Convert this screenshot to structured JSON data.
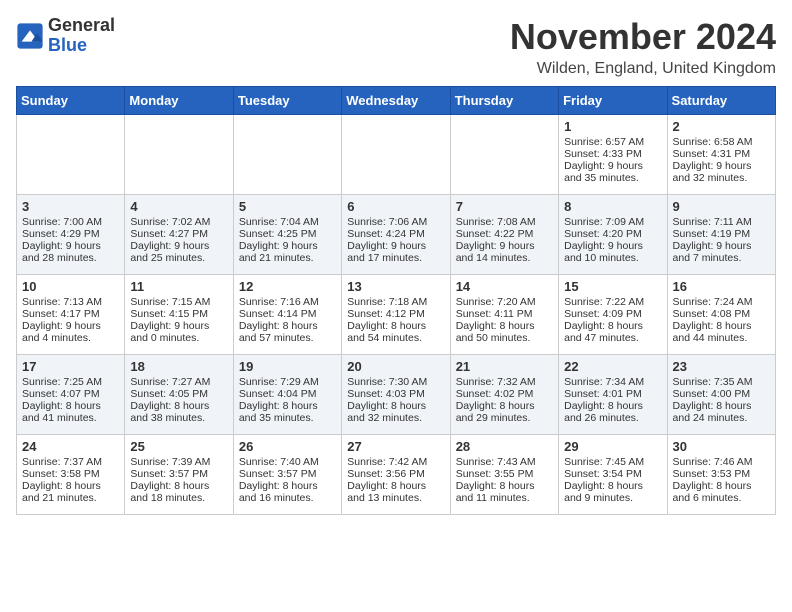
{
  "header": {
    "logo_general": "General",
    "logo_blue": "Blue",
    "month_title": "November 2024",
    "location": "Wilden, England, United Kingdom"
  },
  "days_of_week": [
    "Sunday",
    "Monday",
    "Tuesday",
    "Wednesday",
    "Thursday",
    "Friday",
    "Saturday"
  ],
  "weeks": [
    [
      {
        "day": "",
        "info": ""
      },
      {
        "day": "",
        "info": ""
      },
      {
        "day": "",
        "info": ""
      },
      {
        "day": "",
        "info": ""
      },
      {
        "day": "",
        "info": ""
      },
      {
        "day": "1",
        "info": "Sunrise: 6:57 AM\nSunset: 4:33 PM\nDaylight: 9 hours\nand 35 minutes."
      },
      {
        "day": "2",
        "info": "Sunrise: 6:58 AM\nSunset: 4:31 PM\nDaylight: 9 hours\nand 32 minutes."
      }
    ],
    [
      {
        "day": "3",
        "info": "Sunrise: 7:00 AM\nSunset: 4:29 PM\nDaylight: 9 hours\nand 28 minutes."
      },
      {
        "day": "4",
        "info": "Sunrise: 7:02 AM\nSunset: 4:27 PM\nDaylight: 9 hours\nand 25 minutes."
      },
      {
        "day": "5",
        "info": "Sunrise: 7:04 AM\nSunset: 4:25 PM\nDaylight: 9 hours\nand 21 minutes."
      },
      {
        "day": "6",
        "info": "Sunrise: 7:06 AM\nSunset: 4:24 PM\nDaylight: 9 hours\nand 17 minutes."
      },
      {
        "day": "7",
        "info": "Sunrise: 7:08 AM\nSunset: 4:22 PM\nDaylight: 9 hours\nand 14 minutes."
      },
      {
        "day": "8",
        "info": "Sunrise: 7:09 AM\nSunset: 4:20 PM\nDaylight: 9 hours\nand 10 minutes."
      },
      {
        "day": "9",
        "info": "Sunrise: 7:11 AM\nSunset: 4:19 PM\nDaylight: 9 hours\nand 7 minutes."
      }
    ],
    [
      {
        "day": "10",
        "info": "Sunrise: 7:13 AM\nSunset: 4:17 PM\nDaylight: 9 hours\nand 4 minutes."
      },
      {
        "day": "11",
        "info": "Sunrise: 7:15 AM\nSunset: 4:15 PM\nDaylight: 9 hours\nand 0 minutes."
      },
      {
        "day": "12",
        "info": "Sunrise: 7:16 AM\nSunset: 4:14 PM\nDaylight: 8 hours\nand 57 minutes."
      },
      {
        "day": "13",
        "info": "Sunrise: 7:18 AM\nSunset: 4:12 PM\nDaylight: 8 hours\nand 54 minutes."
      },
      {
        "day": "14",
        "info": "Sunrise: 7:20 AM\nSunset: 4:11 PM\nDaylight: 8 hours\nand 50 minutes."
      },
      {
        "day": "15",
        "info": "Sunrise: 7:22 AM\nSunset: 4:09 PM\nDaylight: 8 hours\nand 47 minutes."
      },
      {
        "day": "16",
        "info": "Sunrise: 7:24 AM\nSunset: 4:08 PM\nDaylight: 8 hours\nand 44 minutes."
      }
    ],
    [
      {
        "day": "17",
        "info": "Sunrise: 7:25 AM\nSunset: 4:07 PM\nDaylight: 8 hours\nand 41 minutes."
      },
      {
        "day": "18",
        "info": "Sunrise: 7:27 AM\nSunset: 4:05 PM\nDaylight: 8 hours\nand 38 minutes."
      },
      {
        "day": "19",
        "info": "Sunrise: 7:29 AM\nSunset: 4:04 PM\nDaylight: 8 hours\nand 35 minutes."
      },
      {
        "day": "20",
        "info": "Sunrise: 7:30 AM\nSunset: 4:03 PM\nDaylight: 8 hours\nand 32 minutes."
      },
      {
        "day": "21",
        "info": "Sunrise: 7:32 AM\nSunset: 4:02 PM\nDaylight: 8 hours\nand 29 minutes."
      },
      {
        "day": "22",
        "info": "Sunrise: 7:34 AM\nSunset: 4:01 PM\nDaylight: 8 hours\nand 26 minutes."
      },
      {
        "day": "23",
        "info": "Sunrise: 7:35 AM\nSunset: 4:00 PM\nDaylight: 8 hours\nand 24 minutes."
      }
    ],
    [
      {
        "day": "24",
        "info": "Sunrise: 7:37 AM\nSunset: 3:58 PM\nDaylight: 8 hours\nand 21 minutes."
      },
      {
        "day": "25",
        "info": "Sunrise: 7:39 AM\nSunset: 3:57 PM\nDaylight: 8 hours\nand 18 minutes."
      },
      {
        "day": "26",
        "info": "Sunrise: 7:40 AM\nSunset: 3:57 PM\nDaylight: 8 hours\nand 16 minutes."
      },
      {
        "day": "27",
        "info": "Sunrise: 7:42 AM\nSunset: 3:56 PM\nDaylight: 8 hours\nand 13 minutes."
      },
      {
        "day": "28",
        "info": "Sunrise: 7:43 AM\nSunset: 3:55 PM\nDaylight: 8 hours\nand 11 minutes."
      },
      {
        "day": "29",
        "info": "Sunrise: 7:45 AM\nSunset: 3:54 PM\nDaylight: 8 hours\nand 9 minutes."
      },
      {
        "day": "30",
        "info": "Sunrise: 7:46 AM\nSunset: 3:53 PM\nDaylight: 8 hours\nand 6 minutes."
      }
    ]
  ]
}
